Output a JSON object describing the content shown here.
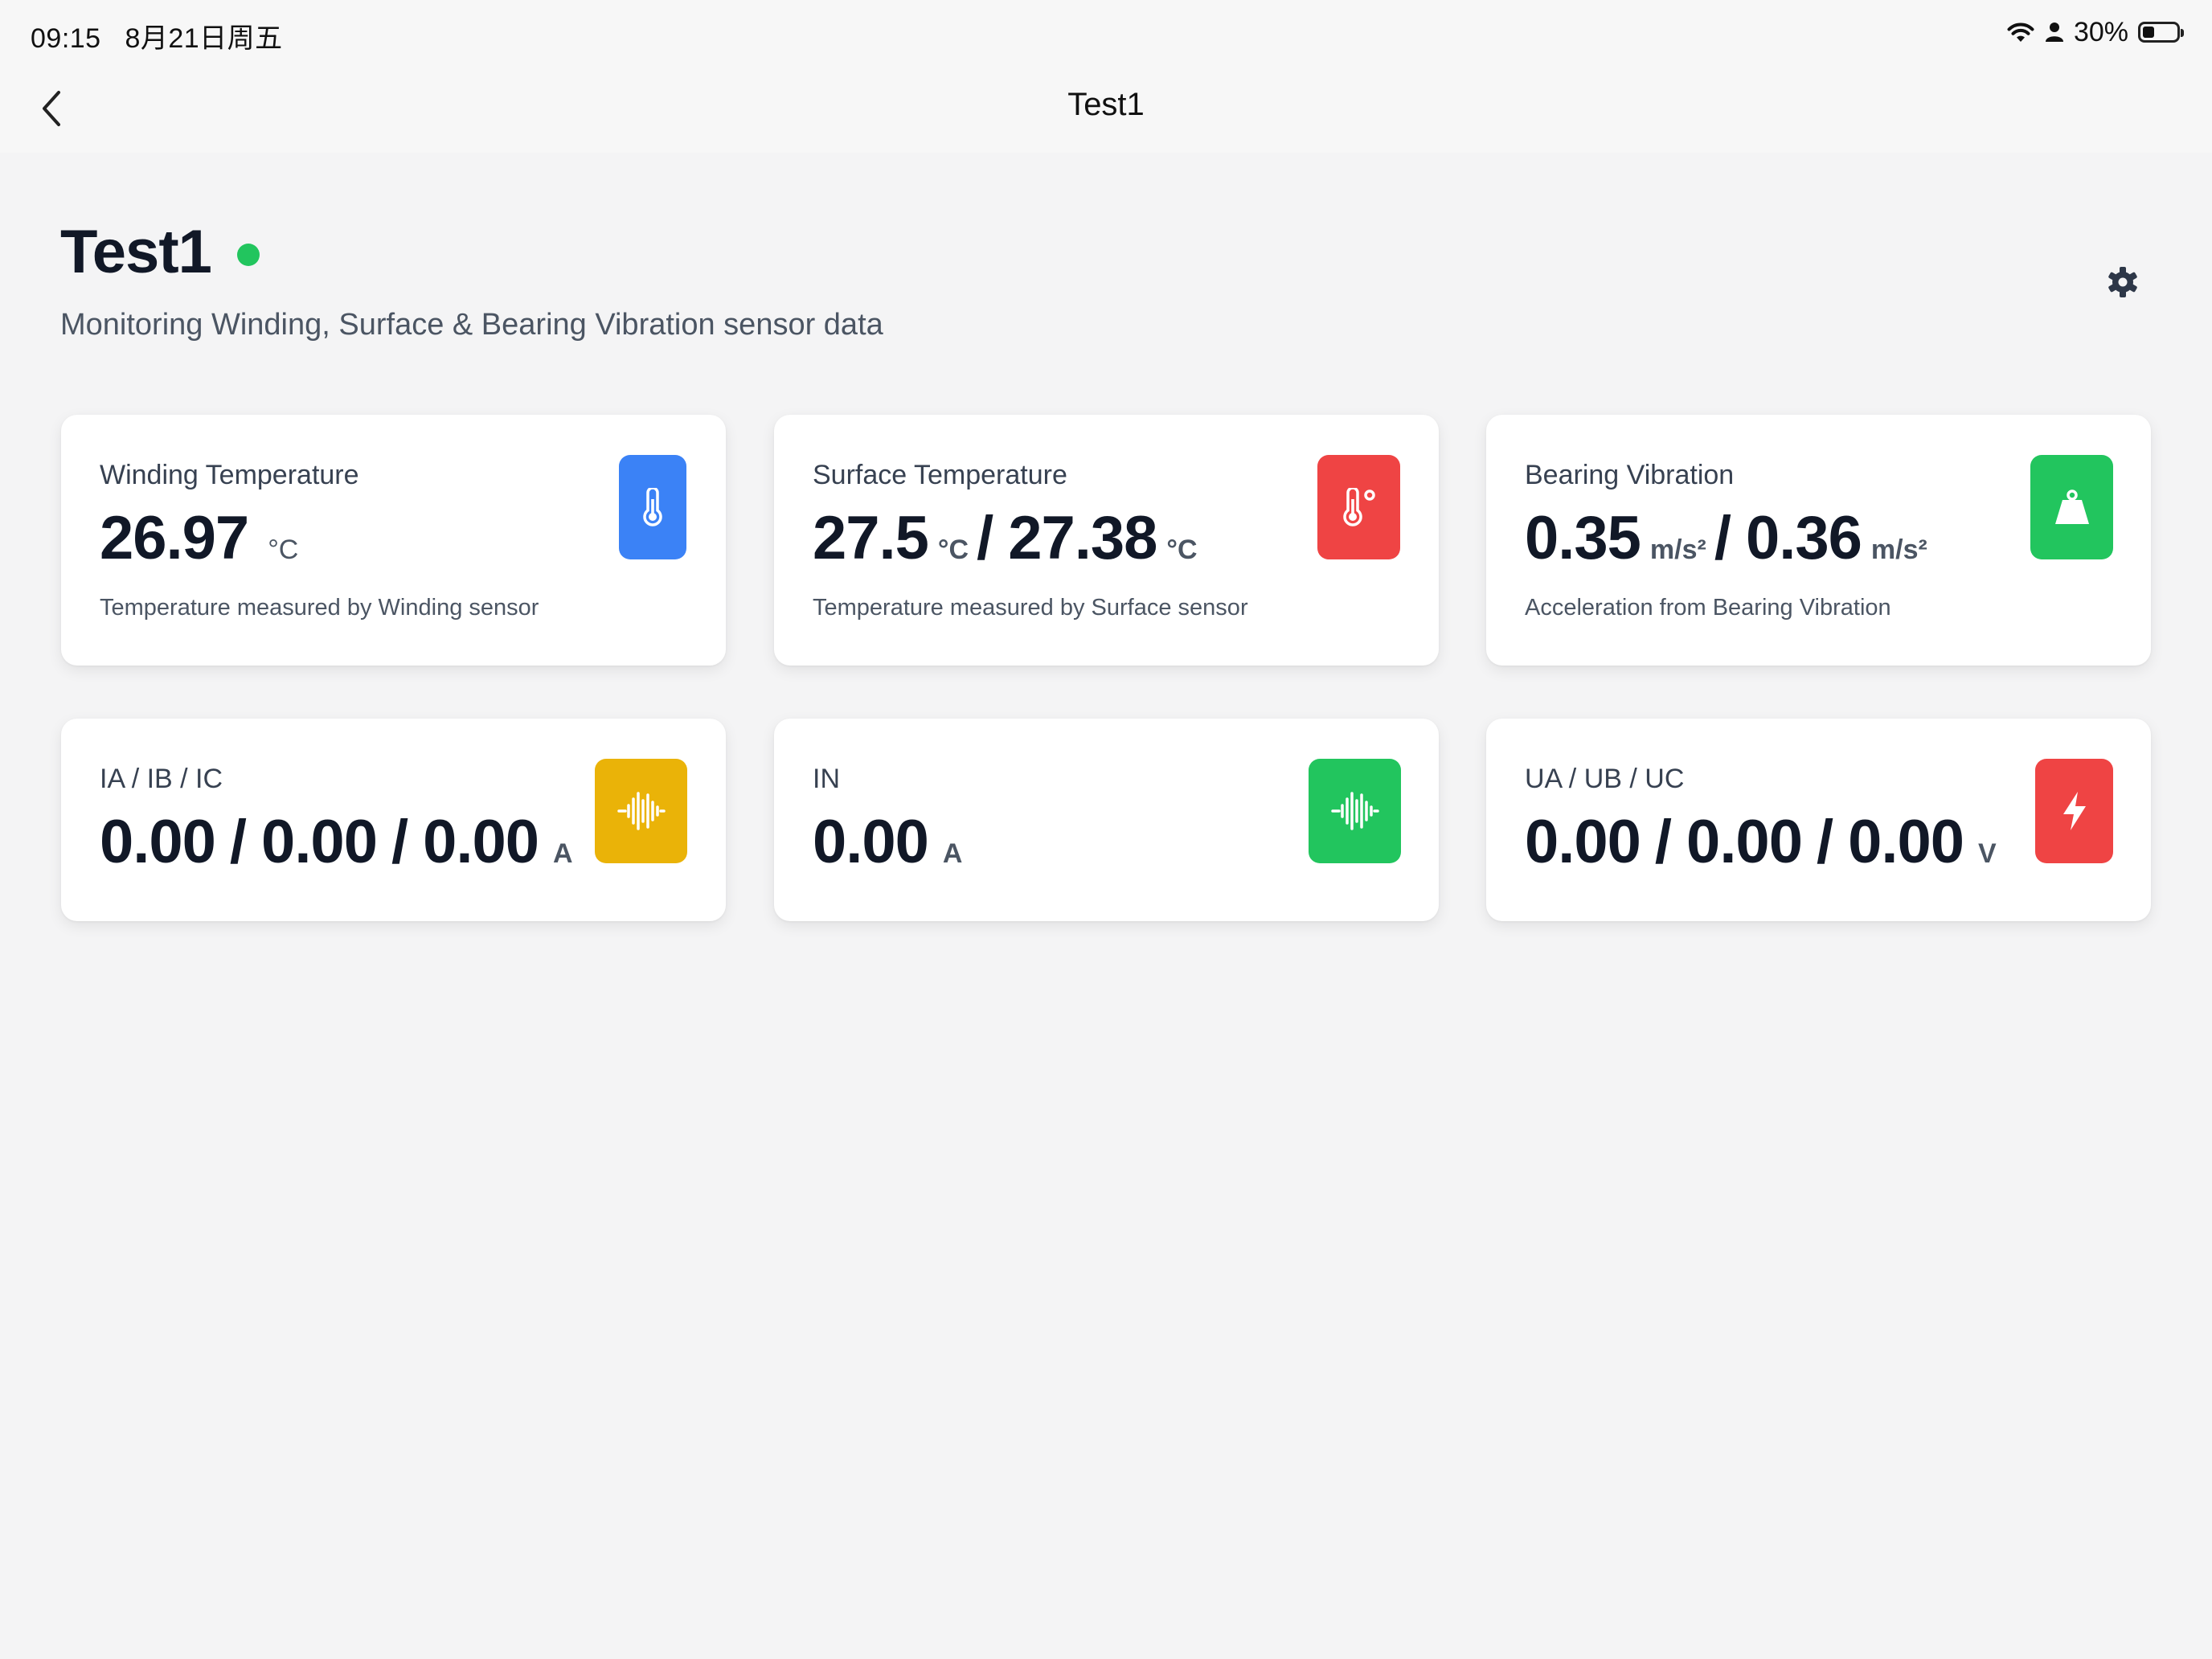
{
  "status_bar": {
    "time": "09:15",
    "date": "8月21日周五",
    "battery": "30%",
    "battery_level": 0.3
  },
  "nav": {
    "title": "Test1"
  },
  "header": {
    "title": "Test1",
    "subtitle": "Monitoring Winding, Surface & Bearing Vibration sensor data",
    "online_color": "#22c55e"
  },
  "cards": {
    "winding": {
      "label": "Winding Temperature",
      "value": "26.97",
      "unit": "°C",
      "description": "Temperature measured by Winding sensor",
      "icon": "thermometer-icon",
      "color": "#3b82f6"
    },
    "surface": {
      "label": "Surface Temperature",
      "value1": "27.5",
      "unit1": "°C",
      "separator": "/",
      "value2": "27.38",
      "unit2": "°C",
      "description": "Temperature measured by Surface sensor",
      "icon": "thermometer-degree-icon",
      "color": "#ef4444"
    },
    "bearing": {
      "label": "Bearing Vibration",
      "value1": "0.35",
      "unit1": "m/s²",
      "separator": "/",
      "value2": "0.36",
      "unit2": "m/s²",
      "description": "Acceleration from Bearing Vibration",
      "icon": "weight-icon",
      "color": "#22c55e"
    },
    "current_abc": {
      "label": "IA / IB / IC",
      "value1": "0.00",
      "value2": "0.00",
      "value3": "0.00",
      "separator": "/",
      "unit": "A",
      "icon": "waveform-icon",
      "color": "#eab308"
    },
    "current_n": {
      "label": "IN",
      "value": "0.00",
      "unit": "A",
      "icon": "waveform-icon",
      "color": "#22c55e"
    },
    "voltage": {
      "label": "UA / UB / UC",
      "value1": "0.00",
      "value2": "0.00",
      "value3": "0.00",
      "separator": "/",
      "unit": "V",
      "icon": "lightning-icon",
      "color": "#ef4444"
    }
  }
}
